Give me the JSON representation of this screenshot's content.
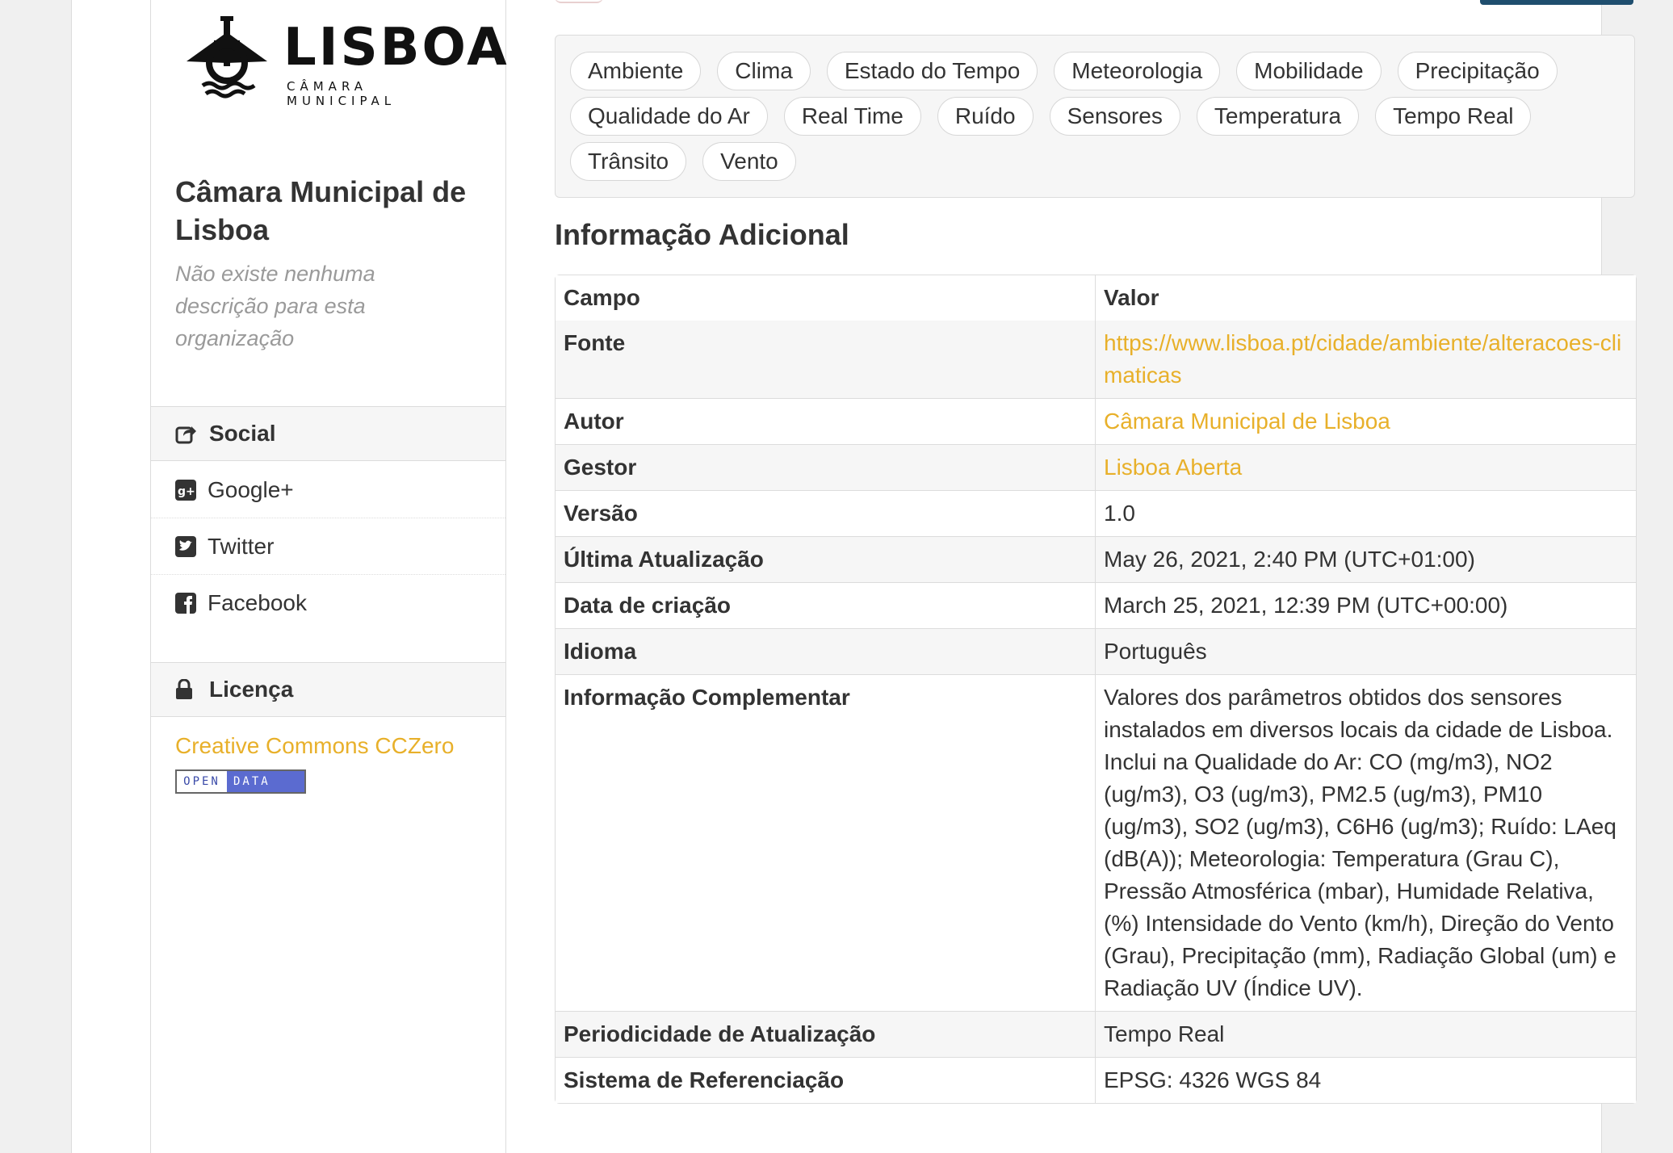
{
  "logo": {
    "word": "LISBOA",
    "sub": "CÂMARA MUNICIPAL"
  },
  "org": {
    "title": "Câmara Municipal de Lisboa",
    "description": "Não existe nenhuma descrição para esta organização"
  },
  "social": {
    "heading": "Social",
    "items": [
      {
        "label": "Google+",
        "icon": "google-plus-icon"
      },
      {
        "label": "Twitter",
        "icon": "twitter-icon"
      },
      {
        "label": "Facebook",
        "icon": "facebook-icon"
      }
    ]
  },
  "license": {
    "heading": "Licença",
    "link": "Creative Commons CCZero",
    "badge_a": "OPEN",
    "badge_b": "DATA"
  },
  "tags": [
    "Ambiente",
    "Clima",
    "Estado do Tempo",
    "Meteorologia",
    "Mobilidade",
    "Precipitação",
    "Qualidade do Ar",
    "Real Time",
    "Ruído",
    "Sensores",
    "Temperatura",
    "Tempo Real",
    "Trânsito",
    "Vento"
  ],
  "additional": {
    "title": "Informação Adicional",
    "col_field": "Campo",
    "col_value": "Valor",
    "rows": [
      {
        "field": "Fonte",
        "value": "https://www.lisboa.pt/cidade/ambiente/alteracoes-climaticas",
        "link": true
      },
      {
        "field": "Autor",
        "value": "Câmara Municipal de Lisboa",
        "link": true
      },
      {
        "field": "Gestor",
        "value": "Lisboa Aberta",
        "link": true
      },
      {
        "field": "Versão",
        "value": "1.0"
      },
      {
        "field": "Última Atualização",
        "value": "May 26, 2021, 2:40 PM (UTC+01:00)"
      },
      {
        "field": "Data de criação",
        "value": "March 25, 2021, 12:39 PM (UTC+00:00)"
      },
      {
        "field": "Idioma",
        "value": "Português"
      },
      {
        "field": "Informação Complementar",
        "value": "Valores dos parâmetros obtidos dos sensores instalados em diversos locais da cidade de Lisboa. Inclui na Qualidade do Ar: CO (mg/m3), NO2 (ug/m3), O3 (ug/m3), PM2.5 (ug/m3), PM10 (ug/m3), SO2 (ug/m3), C6H6 (ug/m3); Ruído: LAeq (dB(A)); Meteorologia: Temperatura (Grau C), Pressão Atmosférica (mbar), Humidade Relativa, (%) Intensidade do Vento (km/h), Direção do Vento (Grau), Precipitação (mm), Radiação Global (um) e Radiação UV (Índice UV)."
      },
      {
        "field": "Periodicidade de Atualização",
        "value": "Tempo Real"
      },
      {
        "field": "Sistema de Referenciação",
        "value": "EPSG: 4326 WGS 84"
      }
    ]
  },
  "colors": {
    "link": "#e8b02a",
    "panel": "#f6f6f6",
    "border": "#dcdcdc",
    "text": "#333333",
    "muted": "#9a9a9a"
  }
}
